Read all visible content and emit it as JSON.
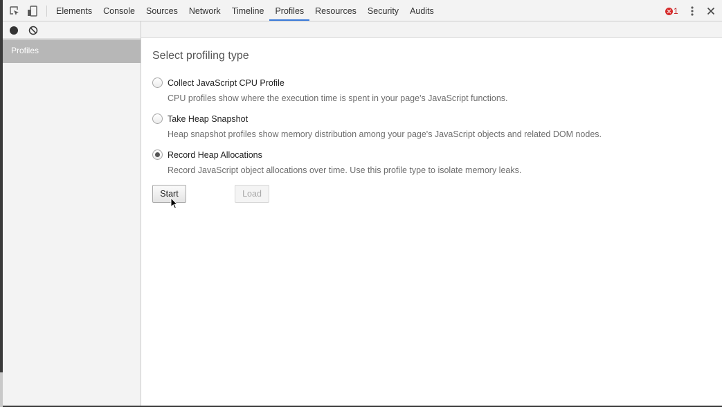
{
  "toolbar": {
    "inspect_icon": "inspect-element-icon",
    "device_icon": "device-mode-icon",
    "tabs": [
      {
        "label": "Elements",
        "selected": false
      },
      {
        "label": "Console",
        "selected": false
      },
      {
        "label": "Sources",
        "selected": false
      },
      {
        "label": "Network",
        "selected": false
      },
      {
        "label": "Timeline",
        "selected": false
      },
      {
        "label": "Profiles",
        "selected": true
      },
      {
        "label": "Resources",
        "selected": false
      },
      {
        "label": "Security",
        "selected": false
      },
      {
        "label": "Audits",
        "selected": false
      }
    ],
    "error_count": "1",
    "error_color": "#d62b2b",
    "accent_color": "#3879d9"
  },
  "sidebar": {
    "record_icon": "record-icon",
    "clear_icon": "clear-icon",
    "items": [
      {
        "label": "Profiles",
        "selected": true
      }
    ]
  },
  "main": {
    "title": "Select profiling type",
    "options": [
      {
        "label": "Collect JavaScript CPU Profile",
        "description": "CPU profiles show where the execution time is spent in your page's JavaScript functions.",
        "checked": false
      },
      {
        "label": "Take Heap Snapshot",
        "description": "Heap snapshot profiles show memory distribution among your page's JavaScript objects and related DOM nodes.",
        "checked": false
      },
      {
        "label": "Record Heap Allocations",
        "description": "Record JavaScript object allocations over time. Use this profile type to isolate memory leaks.",
        "checked": true
      }
    ],
    "start_label": "Start",
    "load_label": "Load"
  }
}
